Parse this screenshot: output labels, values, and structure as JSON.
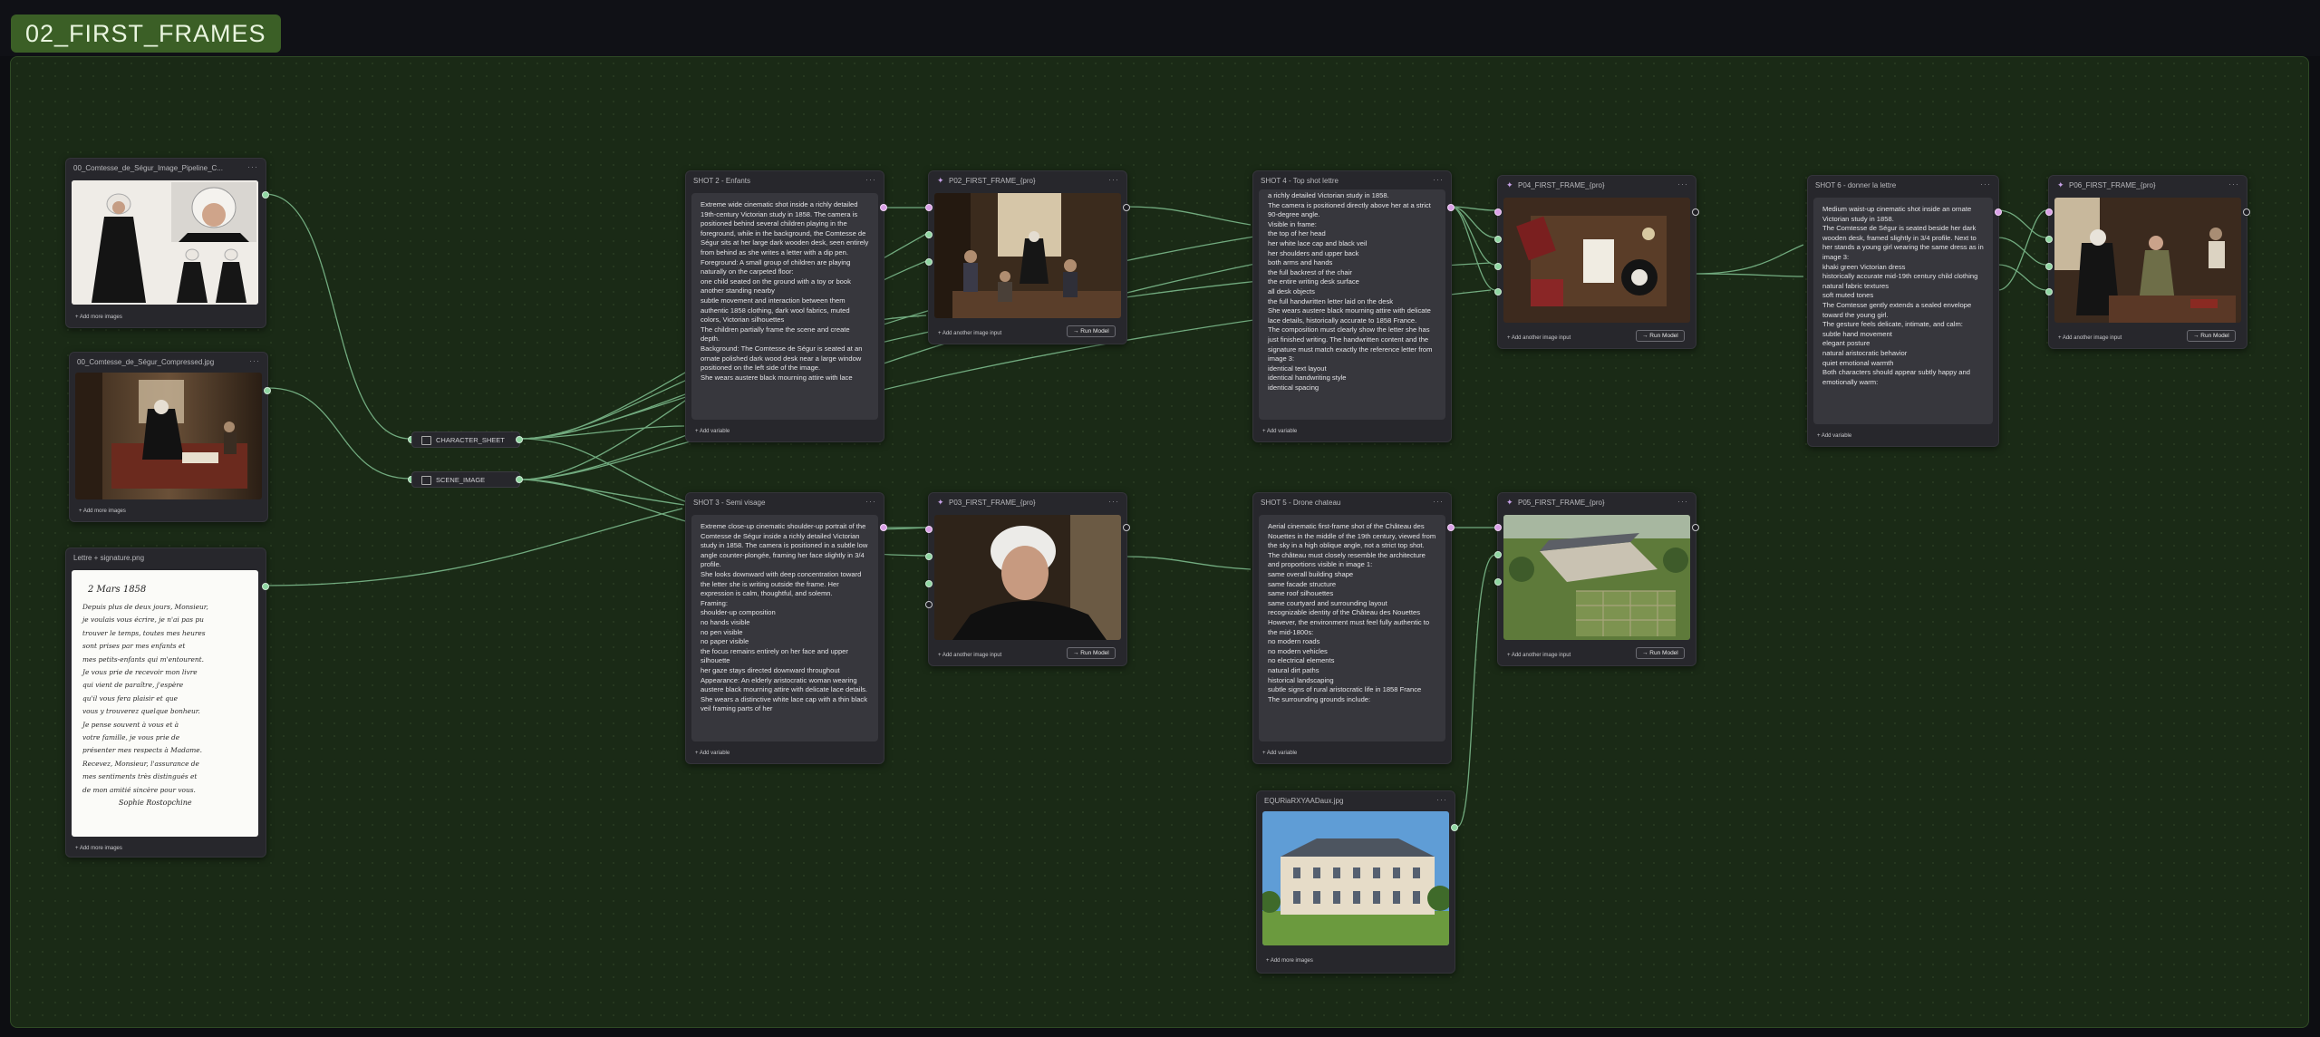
{
  "group": {
    "title": "02_FIRST_FRAMES"
  },
  "common": {
    "add_more_images": "+ Add more images",
    "add_variable": "+ Add variable",
    "add_image_input": "+ Add another image input",
    "run_model": "→ Run Model",
    "menu_dots": "···"
  },
  "nodes": {
    "img1": {
      "title": "00_Comtesse_de_Ségur_Image_Pipeline_C..."
    },
    "img2": {
      "title": "00_Comtesse_de_Ségur_Compressed.jpg"
    },
    "img3": {
      "title": "Lettre + signature.png"
    },
    "img4": {
      "title": "EQURiaRXYAADaux.jpg"
    },
    "char_sheet": {
      "label": "CHARACTER_SHEET"
    },
    "scene_image": {
      "label": "SCENE_IMAGE"
    },
    "shot2": {
      "title": "SHOT 2 - Enfants",
      "lines": [
        "Extreme wide cinematic shot inside a richly detailed 19th-century Victorian study in 1858. The camera is positioned behind several children playing in the foreground, while in the background, the Comtesse de Ségur sits at her large dark wooden desk, seen entirely from behind as she writes a letter with a dip pen.",
        "Foreground: A small group of children are playing naturally on the carpeted floor:",
        "one child seated on the ground with a toy or book",
        "another standing nearby",
        "subtle movement and interaction between them",
        "authentic 1858 clothing, dark wool fabrics, muted colors, Victorian silhouettes",
        "The children partially frame the scene and create depth.",
        "Background: The Comtesse de Ségur is seated at an ornate polished dark wood desk near a large window positioned on the left side of the image.",
        "She wears austere black mourning attire with lace"
      ]
    },
    "shot3": {
      "title": "SHOT 3 - Semi visage",
      "lines": [
        "Extreme close-up cinematic shoulder-up portrait of the Comtesse de Ségur inside a richly detailed Victorian study in 1858. The camera is positioned in a subtle low angle counter-plongée, framing her face slightly in 3/4 profile.",
        "She looks downward with deep concentration toward the letter she is writing outside the frame. Her expression is calm, thoughtful, and solemn.",
        "Framing:",
        "shoulder-up composition",
        "no hands visible",
        "no pen visible",
        "no paper visible",
        "the focus remains entirely on her face and upper silhouette",
        "her gaze stays directed downward throughout",
        "Appearance: An elderly aristocratic woman wearing austere black mourning attire with delicate lace details. She wears a distinctive white lace cap with a thin black veil framing parts of her"
      ]
    },
    "shot4": {
      "title": "SHOT 4 - Top shot lettre",
      "lines": [
        "a richly detailed Victorian study in 1858.",
        "The camera is positioned directly above her at a strict 90-degree angle.",
        "Visible in frame:",
        "the top of her head",
        "her white lace cap and black veil",
        "her shoulders and upper back",
        "both arms and hands",
        "the full backrest of the chair",
        "the entire writing desk surface",
        "all desk objects",
        "the full handwritten letter laid on the desk",
        "She wears austere black mourning attire with delicate lace details, historically accurate to 1858 France.",
        "The composition must clearly show the letter she has just finished writing. The handwritten content and the signature must match exactly the reference letter from image 3:",
        "identical text layout",
        "identical handwriting style",
        "identical spacing"
      ]
    },
    "shot5": {
      "title": "SHOT 5 - Drone chateau",
      "lines": [
        "Aerial cinematic first-frame shot of the Château des Nouettes in the middle of the 19th century, viewed from the sky in a high oblique angle, not a strict top shot.",
        "The château must closely resemble the architecture and proportions visible in image 1:",
        "same overall building shape",
        "same facade structure",
        "same roof silhouettes",
        "same courtyard and surrounding layout",
        "recognizable identity of the Château des Nouettes",
        "However, the environment must feel fully authentic to the mid-1800s:",
        "no modern roads",
        "no modern vehicles",
        "no electrical elements",
        "natural dirt paths",
        "historical landscaping",
        "subtle signs of rural aristocratic life in 1858 France",
        "The surrounding grounds include:"
      ]
    },
    "shot6": {
      "title": "SHOT 6 - donner la lettre",
      "lines": [
        "Medium waist-up cinematic shot inside an ornate Victorian study in 1858.",
        "The Comtesse de Ségur is seated beside her dark wooden desk, framed slightly in 3/4 profile. Next to her stands a young girl wearing the same dress as in image 3:",
        "khaki green Victorian dress",
        "historically accurate mid-19th century child clothing",
        "natural fabric textures",
        "soft muted tones",
        "The Comtesse gently extends a sealed envelope toward the young girl.",
        "The gesture feels delicate, intimate, and calm:",
        "subtle hand movement",
        "elegant posture",
        "natural aristocratic behavior",
        "quiet emotional warmth",
        "Both characters should appear subtly happy and emotionally warm:"
      ]
    },
    "p02": {
      "title": "P02_FIRST_FRAME_{pro}"
    },
    "p03": {
      "title": "P03_FIRST_FRAME_{pro}"
    },
    "p04": {
      "title": "P04_FIRST_FRAME_{pro}"
    },
    "p05": {
      "title": "P05_FIRST_FRAME_{pro}"
    },
    "p06": {
      "title": "P06_FIRST_FRAME_{pro}"
    }
  },
  "letter": {
    "date": "2 Mars 1858",
    "signature": "Sophie Rostopchine",
    "lines": [
      "Depuis plus de deux jours, Monsieur,",
      "je voulais vous écrire, je n'ai pas pu",
      "trouver le temps, toutes mes heures",
      "sont prises par mes enfants et",
      "mes petits-enfants qui m'entourent.",
      "Je vous prie de recevoir mon livre",
      "qui vient de paraître, j'espère",
      "qu'il vous fera plaisir et que",
      "vous y trouverez quelque bonheur.",
      "Je pense souvent à vous et à",
      "votre famille, je vous prie de",
      "présenter mes respects à Madame.",
      "Recevez, Monsieur, l'assurance de",
      "mes sentiments très distingués et",
      "de mon amitié sincère pour vous."
    ]
  },
  "colors": {
    "group_header": "#3b5f26",
    "canvas": "#1a2a16",
    "wire": "#8fd6a2",
    "port_image": "#8fd6a2",
    "port_text": "#d9a0e6",
    "node_bg": "#27272c"
  },
  "icons": {
    "model_node": "sparkle-icon",
    "variable": "image-icon"
  }
}
